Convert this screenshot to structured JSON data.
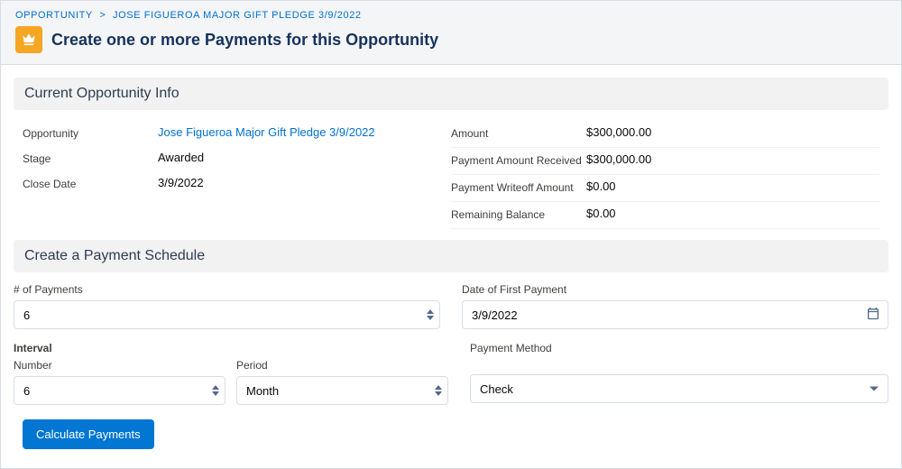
{
  "breadcrumb": {
    "root": "OPPORTUNITY",
    "sep": ">",
    "current": "JOSE FIGUEROA MAJOR GIFT PLEDGE 3/9/2022"
  },
  "page_title": "Create one or more Payments for this Opportunity",
  "sections": {
    "info_title": "Current Opportunity Info",
    "schedule_title": "Create a Payment Schedule"
  },
  "info": {
    "left": {
      "opportunity_label": "Opportunity",
      "opportunity_value": "Jose Figueroa Major Gift Pledge 3/9/2022",
      "stage_label": "Stage",
      "stage_value": "Awarded",
      "close_date_label": "Close Date",
      "close_date_value": "3/9/2022"
    },
    "right": {
      "amount_label": "Amount",
      "amount_value": "$300,000.00",
      "received_label": "Payment Amount Received",
      "received_value": "$300,000.00",
      "writeoff_label": "Payment Writeoff Amount",
      "writeoff_value": "$0.00",
      "remaining_label": "Remaining Balance",
      "remaining_value": "$0.00"
    }
  },
  "form": {
    "num_payments_label": "# of Payments",
    "num_payments_value": "6",
    "first_date_label": "Date of First Payment",
    "first_date_value": "3/9/2022",
    "interval_label": "Interval",
    "number_label": "Number",
    "number_value": "6",
    "period_label": "Period",
    "period_value": "Month",
    "method_label": "Payment Method",
    "method_value": "Check"
  },
  "buttons": {
    "calculate": "Calculate Payments"
  }
}
